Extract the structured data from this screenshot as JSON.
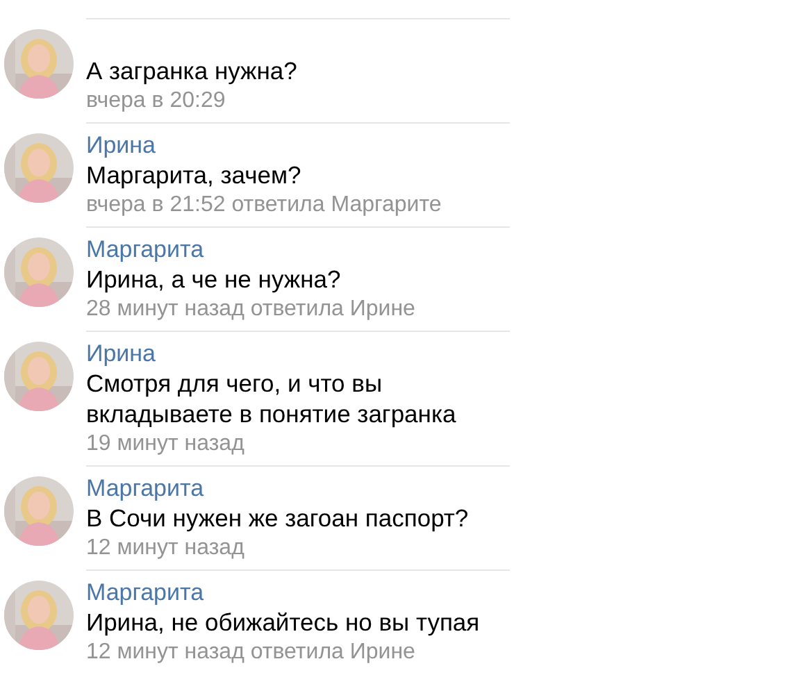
{
  "comments": [
    {
      "text": "А загранка нужна?",
      "meta": "вчера в 20:29"
    },
    {
      "author": "Ирина",
      "text": "Маргарита, зачем?",
      "meta": "вчера в 21:52 ответила Маргарите"
    },
    {
      "author": "Маргарита",
      "text": "Ирина, а че не нужна?",
      "meta": "28 минут назад ответила Ирине"
    },
    {
      "author": "Ирина",
      "text": "Смотря для чего, и что вы вкладываете в понятие загранка",
      "meta": "19 минут назад"
    },
    {
      "author": "Маргарита",
      "text": "В Сочи нужен же загоан паспорт?",
      "meta": "12 минут назад"
    },
    {
      "author": "Маргарита",
      "text": "Ирина, не обижайтесь но вы тупая",
      "meta": "12 минут назад ответила Ирине"
    }
  ]
}
